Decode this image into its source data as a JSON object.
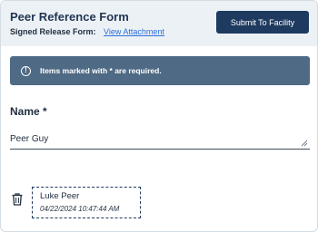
{
  "header": {
    "title": "Peer Reference Form",
    "release_label": "Signed Release Form:",
    "release_link": "View Attachment",
    "submit_label": "Submit To Facility"
  },
  "alert": {
    "icon": "exclamation-icon",
    "text": "Items marked with * are required."
  },
  "name_field": {
    "label": "Name *",
    "value": "Peer Guy"
  },
  "signature": {
    "name": "Luke Peer",
    "timestamp": "04/22/2024 10:47:44 AM",
    "delete_icon": "trash-icon"
  },
  "colors": {
    "header_bg": "#ecf1f6",
    "primary": "#1e3a5f",
    "alert_bg": "#4f6a84",
    "link": "#2e6fd8"
  }
}
